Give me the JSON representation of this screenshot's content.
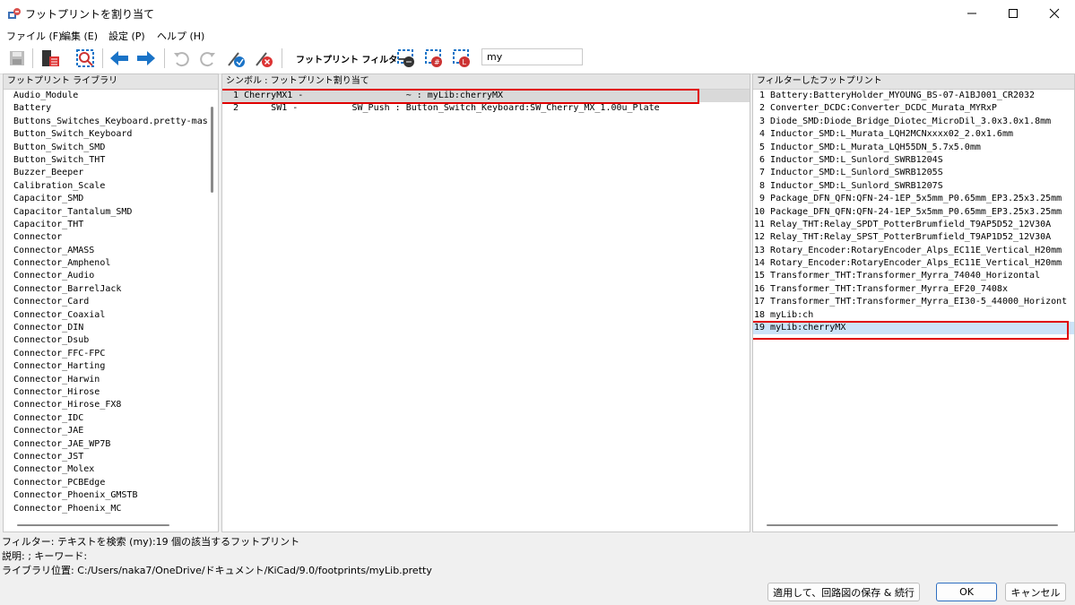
{
  "window": {
    "title": "フットプリントを割り当て"
  },
  "menu": [
    "ファイル (F)",
    "編集 (E)",
    "設定 (P)",
    "ヘルプ (H)"
  ],
  "toolbar": {
    "filter_label": "フットプリント フィルター:",
    "filter_value": "my"
  },
  "libraries": {
    "header": "フットプリント ライブラリ",
    "items": [
      "Audio_Module",
      "Battery",
      "Buttons_Switches_Keyboard.pretty-mas",
      "Button_Switch_Keyboard",
      "Button_Switch_SMD",
      "Button_Switch_THT",
      "Buzzer_Beeper",
      "Calibration_Scale",
      "Capacitor_SMD",
      "Capacitor_Tantalum_SMD",
      "Capacitor_THT",
      "Connector",
      "Connector_AMASS",
      "Connector_Amphenol",
      "Connector_Audio",
      "Connector_BarrelJack",
      "Connector_Card",
      "Connector_Coaxial",
      "Connector_DIN",
      "Connector_Dsub",
      "Connector_FFC-FPC",
      "Connector_Harting",
      "Connector_Harwin",
      "Connector_Hirose",
      "Connector_Hirose_FX8",
      "Connector_IDC",
      "Connector_JAE",
      "Connector_JAE_WP7B",
      "Connector_JST",
      "Connector_Molex",
      "Connector_PCBEdge",
      "Connector_Phoenix_GMSTB",
      "Connector_Phoenix_MC"
    ]
  },
  "components": {
    "header": "シンボル : フットプリント割り当て",
    "rows": [
      {
        "text": "  1 CherryMX1 -                   ~ : myLib:cherryMX"
      },
      {
        "text": "  2      SW1 -          SW_Push : Button_Switch_Keyboard:SW_Cherry_MX_1.00u_Plate"
      }
    ]
  },
  "footprints": {
    "header": "フィルターしたフットプリント",
    "items": [
      " 1 Battery:BatteryHolder_MYOUNG_BS-07-A1BJ001_CR2032",
      " 2 Converter_DCDC:Converter_DCDC_Murata_MYRxP",
      " 3 Diode_SMD:Diode_Bridge_Diotec_MicroDil_3.0x3.0x1.8mm",
      " 4 Inductor_SMD:L_Murata_LQH2MCNxxxx02_2.0x1.6mm",
      " 5 Inductor_SMD:L_Murata_LQH55DN_5.7x5.0mm",
      " 6 Inductor_SMD:L_Sunlord_SWRB1204S",
      " 7 Inductor_SMD:L_Sunlord_SWRB1205S",
      " 8 Inductor_SMD:L_Sunlord_SWRB1207S",
      " 9 Package_DFN_QFN:QFN-24-1EP_5x5mm_P0.65mm_EP3.25x3.25mm",
      "10 Package_DFN_QFN:QFN-24-1EP_5x5mm_P0.65mm_EP3.25x3.25mm",
      "11 Relay_THT:Relay_SPDT_PotterBrumfield_T9AP5D52_12V30A",
      "12 Relay_THT:Relay_SPST_PotterBrumfield_T9AP1D52_12V30A",
      "13 Rotary_Encoder:RotaryEncoder_Alps_EC11E_Vertical_H20mm",
      "14 Rotary_Encoder:RotaryEncoder_Alps_EC11E_Vertical_H20mm",
      "15 Transformer_THT:Transformer_Myrra_74040_Horizontal",
      "16 Transformer_THT:Transformer_Myrra_EF20_7408x",
      "17 Transformer_THT:Transformer_Myrra_EI30-5_44000_Horizont",
      "18 myLib:ch",
      "19 myLib:cherryMX"
    ],
    "selected_index": 18
  },
  "status": {
    "line1": "フィルター: テキストを検索 (my):19 個の該当するフットプリント",
    "line2": "説明: ; キーワード:",
    "line3": "ライブラリ位置: C:/Users/naka7/OneDrive/ドキュメント/KiCad/9.0/footprints/myLib.pretty"
  },
  "buttons": {
    "apply": "適用して、回路図の保存 & 続行",
    "ok": "OK",
    "cancel": "キャンセル"
  },
  "colors": {
    "highlight_box": "#e00000",
    "selection": "#cce3f8",
    "accent_blue": "#1a73c7"
  }
}
